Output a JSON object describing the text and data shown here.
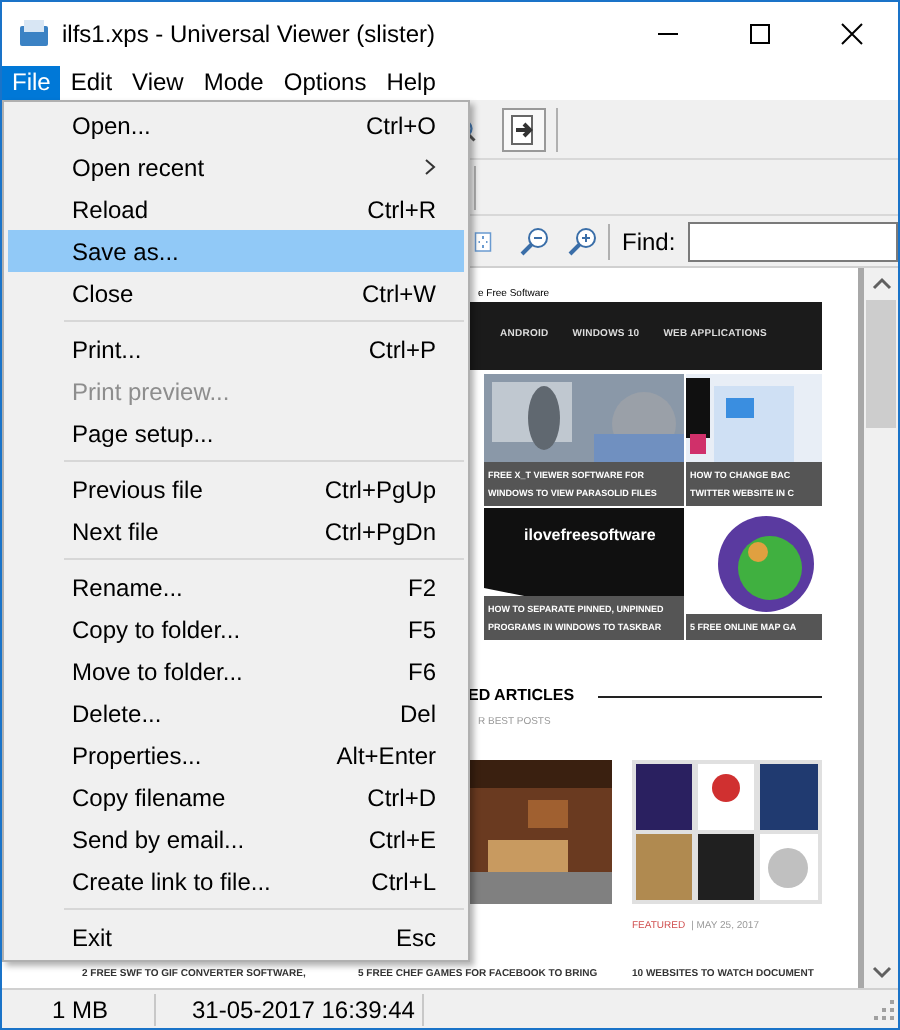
{
  "window": {
    "title": "ilfs1.xps - Universal Viewer (slister)"
  },
  "menubar": [
    {
      "label": "File",
      "selected": true
    },
    {
      "label": "Edit",
      "selected": false
    },
    {
      "label": "View",
      "selected": false
    },
    {
      "label": "Mode",
      "selected": false
    },
    {
      "label": "Options",
      "selected": false
    },
    {
      "label": "Help",
      "selected": false
    }
  ],
  "file_menu": [
    {
      "kind": "item",
      "label": "Open...",
      "shortcut": "Ctrl+O",
      "selected": false,
      "disabled": false
    },
    {
      "kind": "submenu",
      "label": "Open recent",
      "selected": false,
      "disabled": false
    },
    {
      "kind": "item",
      "label": "Reload",
      "shortcut": "Ctrl+R",
      "selected": false,
      "disabled": false
    },
    {
      "kind": "item",
      "label": "Save as...",
      "selected": true,
      "disabled": false
    },
    {
      "kind": "item",
      "label": "Close",
      "shortcut": "Ctrl+W",
      "selected": false,
      "disabled": false
    },
    {
      "kind": "separator"
    },
    {
      "kind": "item",
      "label": "Print...",
      "shortcut": "Ctrl+P",
      "selected": false,
      "disabled": false
    },
    {
      "kind": "item",
      "label": "Print preview...",
      "selected": false,
      "disabled": true
    },
    {
      "kind": "item",
      "label": "Page setup...",
      "selected": false,
      "disabled": false
    },
    {
      "kind": "separator"
    },
    {
      "kind": "item",
      "label": "Previous file",
      "shortcut": "Ctrl+PgUp",
      "selected": false,
      "disabled": false
    },
    {
      "kind": "item",
      "label": "Next file",
      "shortcut": "Ctrl+PgDn",
      "selected": false,
      "disabled": false
    },
    {
      "kind": "separator"
    },
    {
      "kind": "item",
      "label": "Rename...",
      "shortcut": "F2",
      "selected": false,
      "disabled": false
    },
    {
      "kind": "item",
      "label": "Copy to folder...",
      "shortcut": "F5",
      "selected": false,
      "disabled": false
    },
    {
      "kind": "item",
      "label": "Move to folder...",
      "shortcut": "F6",
      "selected": false,
      "disabled": false
    },
    {
      "kind": "item",
      "label": "Delete...",
      "shortcut": "Del",
      "selected": false,
      "disabled": false
    },
    {
      "kind": "item",
      "label": "Properties...",
      "shortcut": "Alt+Enter",
      "selected": false,
      "disabled": false
    },
    {
      "kind": "item",
      "label": "Copy filename",
      "shortcut": "Ctrl+D",
      "selected": false,
      "disabled": false
    },
    {
      "kind": "item",
      "label": "Send by email...",
      "shortcut": "Ctrl+E",
      "selected": false,
      "disabled": false
    },
    {
      "kind": "item",
      "label": "Create link to file...",
      "shortcut": "Ctrl+L",
      "selected": false,
      "disabled": false
    },
    {
      "kind": "separator"
    },
    {
      "kind": "item",
      "label": "Exit",
      "shortcut": "Esc",
      "selected": false,
      "disabled": false
    }
  ],
  "find": {
    "label": "Find:"
  },
  "document": {
    "site_name": "e Free Software",
    "nav": [
      "ANDROID",
      "WINDOWS 10",
      "WEB APPLICATIONS"
    ],
    "tiles": [
      {
        "kind": "picture",
        "caption": [
          "FREE X_T VIEWER SOFTWARE FOR",
          "WINDOWS TO VIEW PARASOLID FILES"
        ]
      },
      {
        "kind": "picture",
        "caption": [
          "HOW TO CHANGE BAC",
          "TWITTER WEBSITE IN C"
        ]
      },
      {
        "kind": "picture",
        "logo": "ilovefreesoftware",
        "caption": [
          "HOW TO SEPARATE PINNED, UNPINNED",
          "PROGRAMS IN WINDOWS TO TASKBAR"
        ]
      },
      {
        "kind": "picture",
        "caption": [
          "5 FREE ONLINE MAP GA"
        ]
      }
    ],
    "section_title": "ED ARTICLES",
    "section_subtitle": "R BEST POSTS",
    "post_tag": "FEATURED",
    "post_date": "| MAY 25, 2017",
    "post_titles": [
      "2 FREE SWF TO GIF CONVERTER SOFTWARE,",
      "5 FREE CHEF GAMES FOR FACEBOOK TO BRING",
      "10 WEBSITES TO WATCH DOCUMENT"
    ]
  },
  "status_bar": [
    "1 MB",
    "31-05-2017 16:39:44"
  ]
}
